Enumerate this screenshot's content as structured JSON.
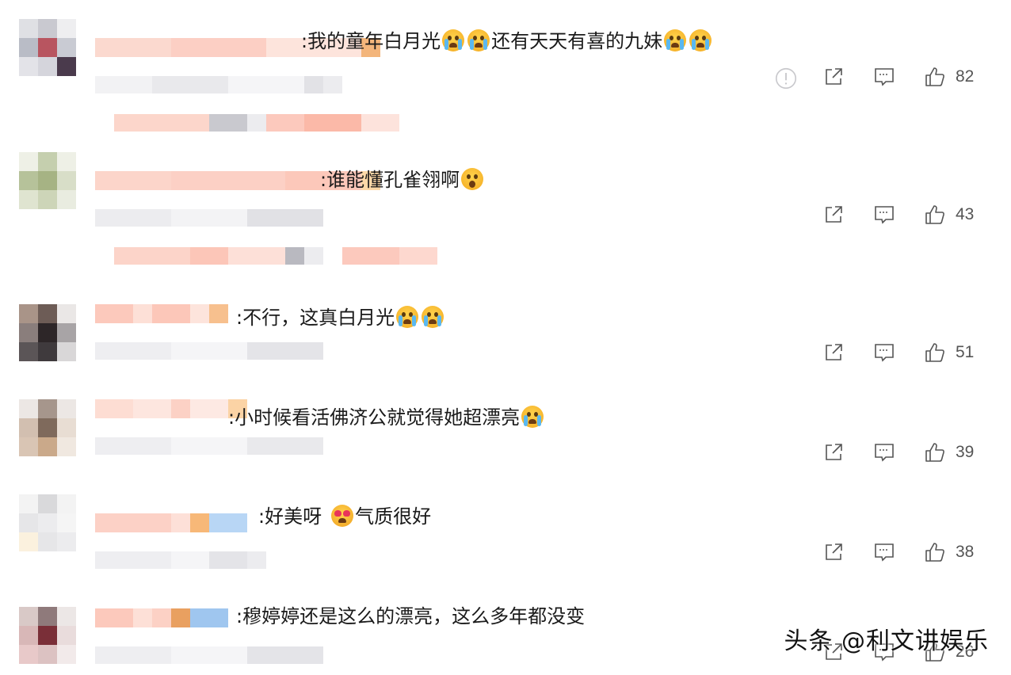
{
  "comments": [
    {
      "text": ":我的童年白月光",
      "text2": "还有天天有喜的九妹",
      "likes": "82"
    },
    {
      "text": ":谁能懂孔雀翎啊",
      "likes": "43"
    },
    {
      "text": ":不行，这真白月光",
      "likes": "51"
    },
    {
      "text": ":小时候看活佛济公就觉得她超漂亮",
      "likes": "39"
    },
    {
      "text": ":好美呀",
      "text2": "气质很好",
      "likes": "38"
    },
    {
      "text": ":穆婷婷还是这么的漂亮，这么多年都没变",
      "likes": "26"
    }
  ],
  "icons": {
    "report": "warning-icon",
    "share": "share-icon",
    "reply": "comment-icon",
    "like": "thumbs-up-icon",
    "emoji_cry": "crying-emoji-icon",
    "emoji_shock": "shocked-emoji-icon",
    "emoji_heart": "heart-eyes-emoji-icon"
  },
  "watermark": "头条 @利文讲娱乐"
}
